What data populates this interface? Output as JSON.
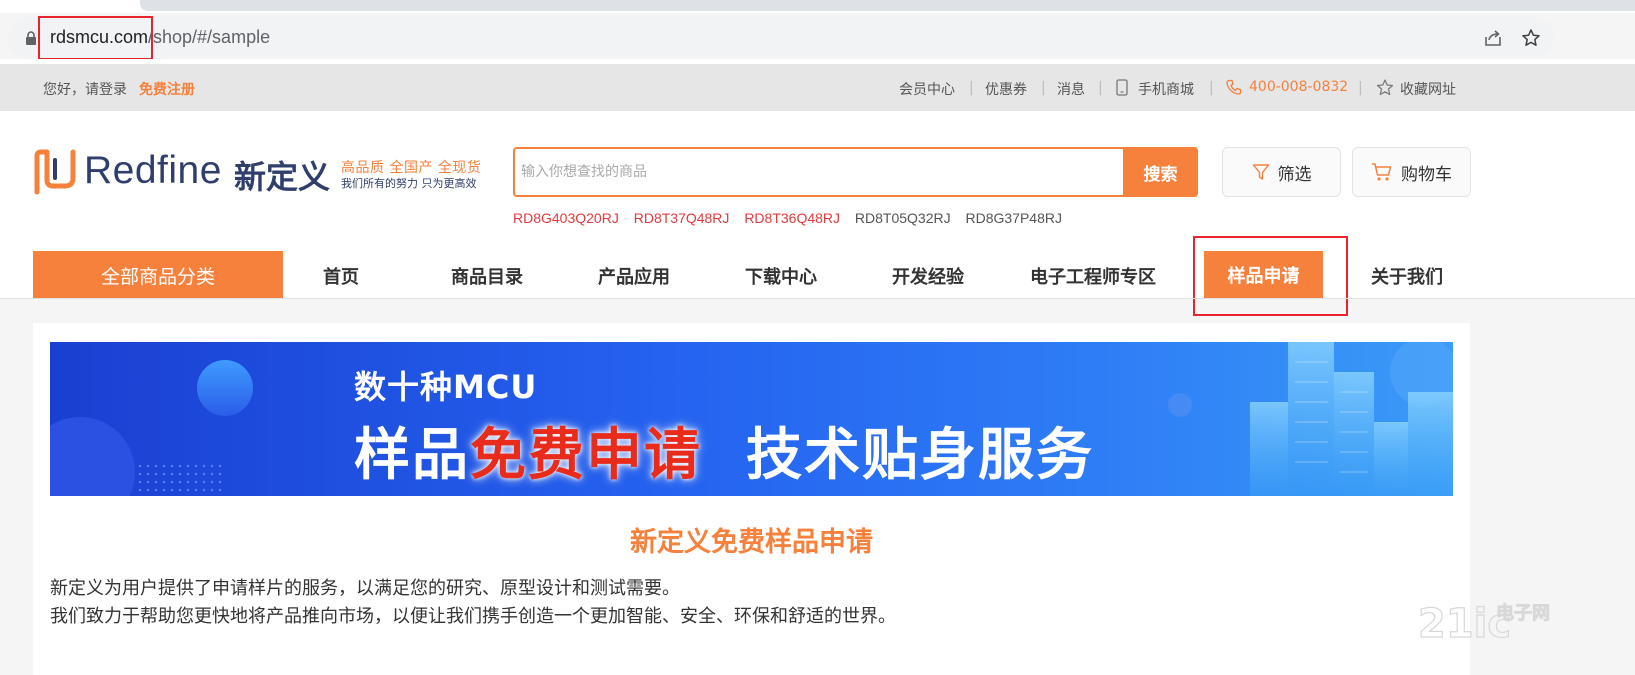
{
  "browser": {
    "url_domain": "rdsmcu.com",
    "url_path": "/shop/#/sample"
  },
  "topbar": {
    "greeting": "您好，请登录",
    "register": "免费注册",
    "links": {
      "member": "会员中心",
      "coupons": "优惠券",
      "messages": "消息",
      "mobile": "手机商城",
      "phone": "400-008-0832",
      "bookmark": "收藏网址"
    }
  },
  "header": {
    "logo_text": "Redfine",
    "logo_cn": "新定义",
    "slogan_main": "高品质 全国产 全现货",
    "slogan_sub": "我们所有的努力 只为更高效",
    "search": {
      "placeholder": "输入你想查找的商品",
      "button": "搜索"
    },
    "hot_links": [
      {
        "text": "RD8G403Q20RJ",
        "color": "#e4393c"
      },
      {
        "text": "RD8T37Q48RJ",
        "color": "#e4393c"
      },
      {
        "text": "RD8T36Q48RJ",
        "color": "#e4393c"
      },
      {
        "text": "RD8T05Q32RJ",
        "color": "#555555"
      },
      {
        "text": "RD8G37P48RJ",
        "color": "#555555"
      }
    ],
    "filter_label": "筛选",
    "cart_label": "购物车"
  },
  "nav": {
    "all_categories": "全部商品分类",
    "items": [
      "首页",
      "商品目录",
      "产品应用",
      "下载中心",
      "开发经验",
      "电子工程师专区",
      "样品申请",
      "关于我们"
    ],
    "active": "样品申请"
  },
  "banner": {
    "line1": "数十种MCU",
    "line2_a": "样品",
    "line2_b": "免费申请",
    "line2_c": "技术贴身服务"
  },
  "content": {
    "title": "新定义免费样品申请",
    "paragraph1": "新定义为用户提供了申请样片的服务，以满足您的研究、原型设计和测试需要。",
    "paragraph2": "我们致力于帮助您更快地将产品推向市场，以便让我们携手创造一个更加智能、安全、环保和舒适的世界。"
  },
  "watermark": {
    "brand": "21ic",
    "cn": "电子网"
  },
  "colors": {
    "accent": "#f5813d",
    "brand_navy": "#2f3e6b",
    "highlight_red": "#e8232b"
  }
}
